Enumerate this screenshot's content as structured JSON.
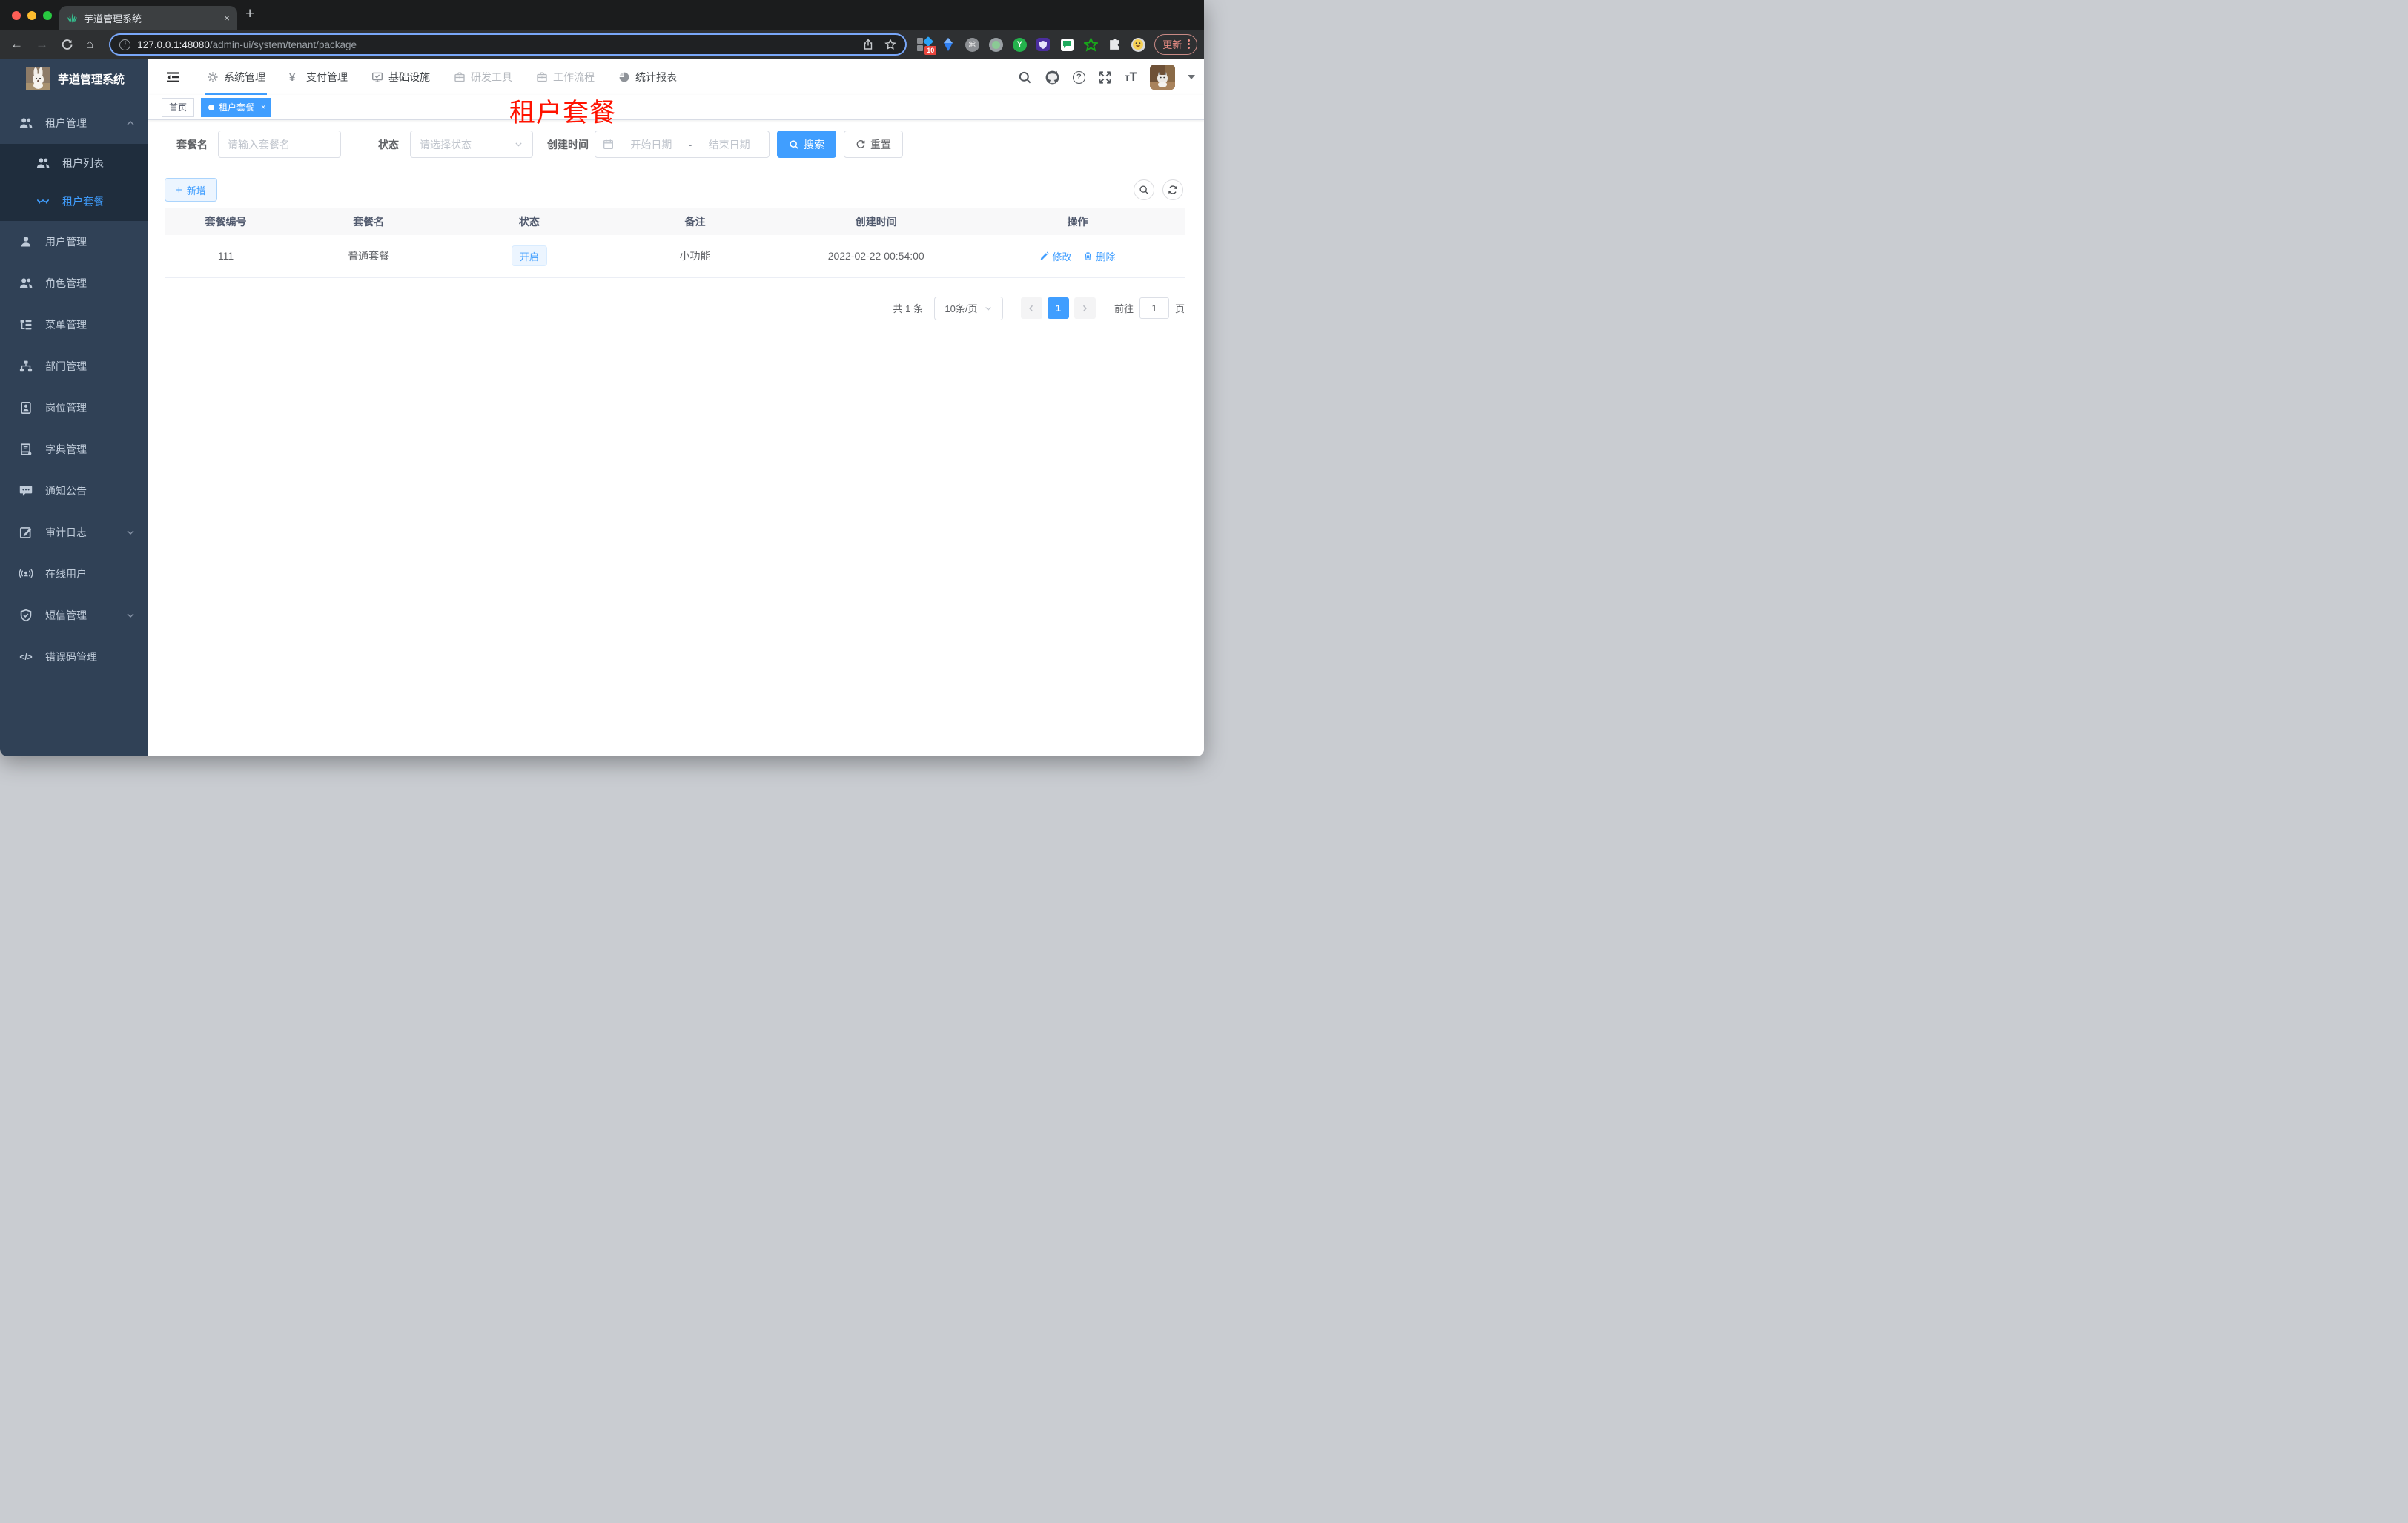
{
  "browser": {
    "tab_title": "芋道管理系统",
    "url_host": "127.0.0.1:48080",
    "url_path": "/admin-ui/system/tenant/package",
    "update_label": "更新",
    "extension_badge": "10"
  },
  "glyphs": {
    "back": "←",
    "forward": "→",
    "home": "⌂",
    "new_tab": "+",
    "close_tab": "×",
    "command": "⌘",
    "y_ext": "Y",
    "question": "?",
    "plus": "+",
    "tag_close": "×",
    "code": "</>",
    "yen": "¥",
    "font_small": "T",
    "font_large": "T",
    "info": "i"
  },
  "app": {
    "logo_title": "芋道管理系统"
  },
  "topnav": {
    "items": [
      {
        "label": "系统管理"
      },
      {
        "label": "支付管理"
      },
      {
        "label": "基础设施"
      },
      {
        "label": "研发工具"
      },
      {
        "label": "工作流程"
      },
      {
        "label": "统计报表"
      }
    ]
  },
  "sidebar": {
    "items": [
      {
        "label": "租户管理"
      },
      {
        "label": "租户列表"
      },
      {
        "label": "租户套餐"
      },
      {
        "label": "用户管理"
      },
      {
        "label": "角色管理"
      },
      {
        "label": "菜单管理"
      },
      {
        "label": "部门管理"
      },
      {
        "label": "岗位管理"
      },
      {
        "label": "字典管理"
      },
      {
        "label": "通知公告"
      },
      {
        "label": "审计日志"
      },
      {
        "label": "在线用户"
      },
      {
        "label": "短信管理"
      },
      {
        "label": "错误码管理"
      }
    ]
  },
  "tags": {
    "home": "首页",
    "active": "租户套餐"
  },
  "overlay_title": "租户套餐",
  "filters": {
    "name_label": "套餐名",
    "name_placeholder": "请输入套餐名",
    "status_label": "状态",
    "status_placeholder": "请选择状态",
    "date_label": "创建时间",
    "date_start_placeholder": "开始日期",
    "date_separator": "-",
    "date_end_placeholder": "结束日期",
    "search_label": "搜索",
    "reset_label": "重置"
  },
  "toolbar": {
    "add_label": "新增"
  },
  "table": {
    "headers": [
      "套餐编号",
      "套餐名",
      "状态",
      "备注",
      "创建时间",
      "操作"
    ],
    "rows": [
      {
        "package_id": "111",
        "name": "普通套餐",
        "status": "开启",
        "remark": "小功能",
        "created_at": "2022-02-22 00:54:00",
        "edit_label": "修改",
        "delete_label": "删除"
      }
    ]
  },
  "pagination": {
    "total": "共 1 条",
    "page_size": "10条/页",
    "current_page": "1",
    "goto_label": "前往",
    "goto_value": "1",
    "page_unit": "页"
  },
  "colors": {
    "accent": "#409eff",
    "sidebar_bg": "#304156",
    "submenu_bg": "#1f2d3d",
    "title_red": "#ff1200",
    "status_tag_bg": "#ecf5ff",
    "table_header_bg": "#f8f8f9"
  }
}
